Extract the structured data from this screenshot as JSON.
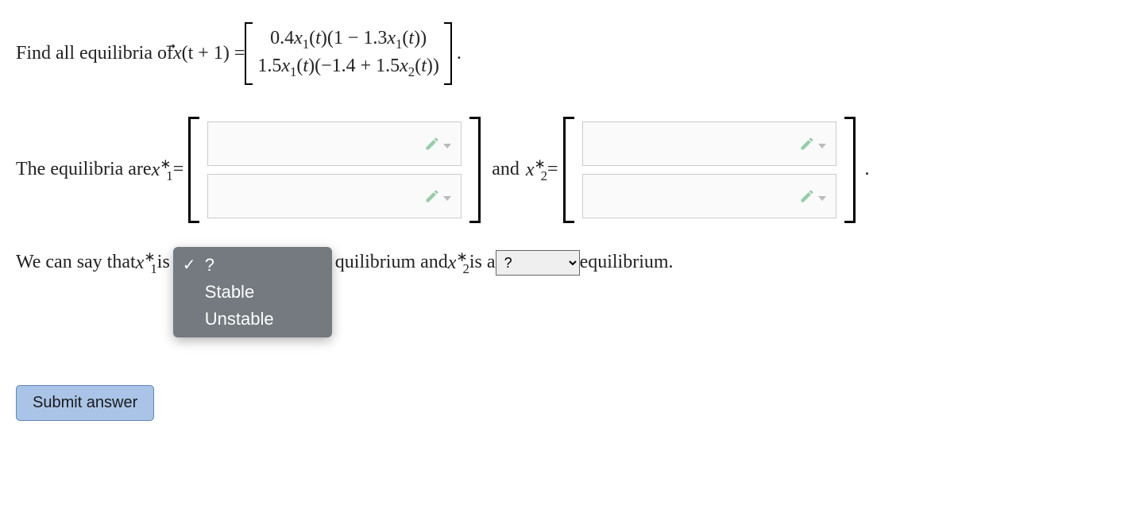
{
  "problem": {
    "lead": "Find all equilibria of ",
    "lhs_prefix": "x",
    "lhs_arg": "(t + 1) = ",
    "matrix_row1": "0.4x₁(t)(1 − 1.3x₁(t))",
    "matrix_row2": "1.5x₁(t)(−1.4 + 1.5x₂(t))",
    "trailing_period": "."
  },
  "equilibria_line": {
    "lead": "The equilibria are ",
    "x1_label_pre": "x",
    "x1_sub": "1",
    "x1_star": "∗",
    "eq": " = ",
    "and": " and ",
    "x2_sub": "2",
    "trailing_period": "."
  },
  "stability_line": {
    "lead": "We can say that ",
    "is": " is ",
    "mid_fragment": "quilibrium and ",
    "is_a": " is a ",
    "tail": " equilibrium."
  },
  "dropdown1": {
    "selected": "?",
    "options": [
      "?",
      "Stable",
      "Unstable"
    ]
  },
  "dropdown2": {
    "selected": "?",
    "options": [
      "?",
      "Stable",
      "Unstable"
    ]
  },
  "submit_label": "Submit answer",
  "icons": {
    "edit": "edit-icon"
  }
}
